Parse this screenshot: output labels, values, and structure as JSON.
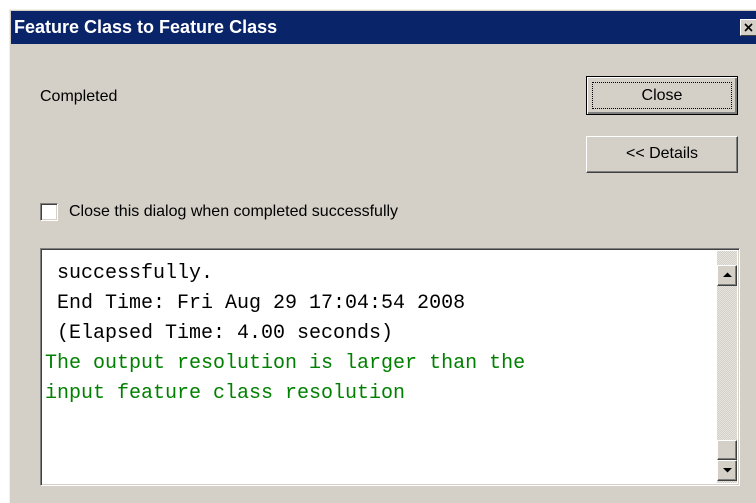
{
  "window": {
    "title": "Feature Class to Feature Class"
  },
  "status": {
    "text": "Completed"
  },
  "buttons": {
    "close_label": "Close",
    "details_label": "<< Details"
  },
  "options": {
    "close_when_completed_label": "Close this dialog when completed successfully",
    "close_when_completed_checked": false
  },
  "log": {
    "lines": [
      {
        "text": " successfully.",
        "kind": "normal"
      },
      {
        "text": " End Time: Fri Aug 29 17:04:54 2008",
        "kind": "normal"
      },
      {
        "text": " (Elapsed Time: 4.00 seconds)",
        "kind": "normal"
      },
      {
        "text": "The output resolution is larger than the",
        "kind": "warning"
      },
      {
        "text": "input feature class resolution",
        "kind": "warning"
      }
    ]
  },
  "icons": {
    "title_close": "close-icon",
    "scroll_up": "arrow-up-icon",
    "scroll_down": "arrow-down-icon"
  },
  "colors": {
    "titlebar": "#0a246a",
    "dialog_face": "#d4d0c8",
    "warning_text": "#008000"
  }
}
